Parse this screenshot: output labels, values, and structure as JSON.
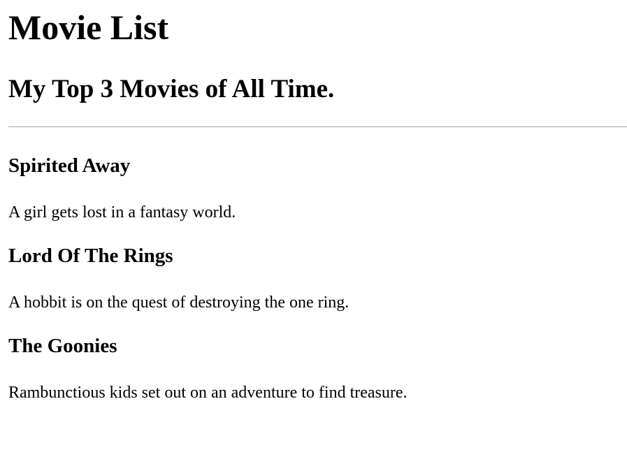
{
  "page": {
    "title": "Movie List",
    "subtitle": "My Top 3 Movies of All Time."
  },
  "movies": [
    {
      "title": "Spirited Away",
      "description": "A girl gets lost in a fantasy world."
    },
    {
      "title": "Lord Of The Rings",
      "description": "A hobbit is on the quest of destroying the one ring."
    },
    {
      "title": "The Goonies",
      "description": "Rambunctious kids set out on an adventure to find treasure."
    }
  ],
  "colors": {
    "text": "#000000",
    "background": "#ffffff",
    "divider": "#a3a3a3"
  }
}
